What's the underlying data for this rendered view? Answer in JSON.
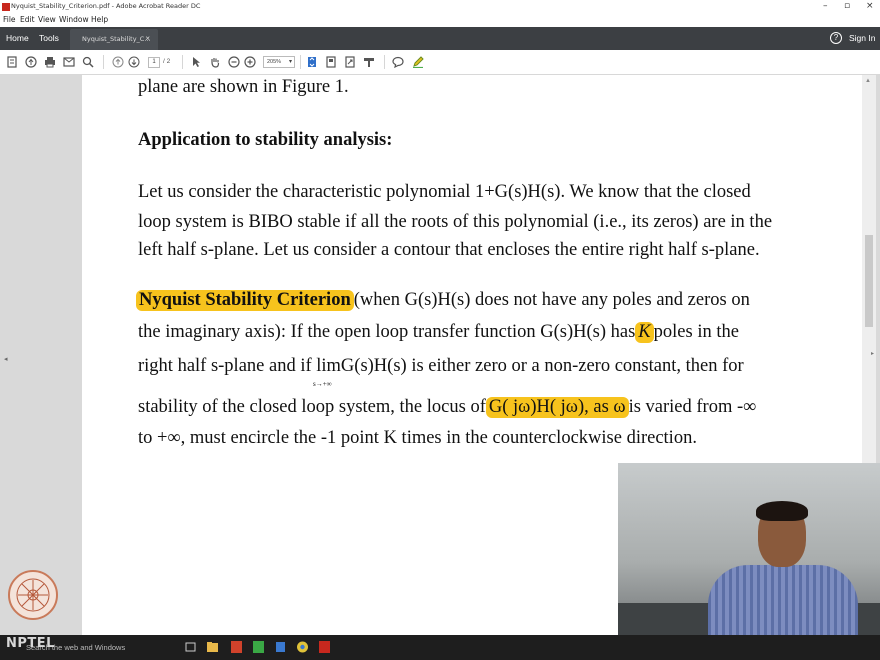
{
  "window": {
    "title": "Nyquist_Stability_Criterion.pdf - Adobe Acrobat Reader DC",
    "minimize": "–",
    "restore": "▫",
    "close": "×"
  },
  "menu": [
    "File",
    "Edit",
    "View",
    "Window",
    "Help"
  ],
  "tabs": {
    "home": "Home",
    "tools": "Tools",
    "document": "Nyquist_Stability_C...",
    "close": "×",
    "help": "?",
    "sign_in": "Sign In"
  },
  "toolbar": {
    "page_current": "1",
    "page_total": "/ 2",
    "zoom": "205%"
  },
  "document": {
    "line_prev": "plane are shown in Figure 1.",
    "heading": "Application to stability analysis:",
    "para1": [
      "Let us consider the characteristic polynomial 1+G(s)H(s). We know that the closed",
      "loop system is BIBO stable if all the roots of this polynomial (i.e., its zeros) are in the",
      "left half s-plane. Let us consider a contour that encloses the entire right half s-plane."
    ],
    "criterion_title": "Nyquist Stability Criterion",
    "crit_l1_rest": "(when  G(s)H(s)  does not have any poles and zeros on",
    "crit_l2_a": "the imaginary axis): If the open loop transfer function  G(s)H(s)  has",
    "crit_l2_k": "K",
    "crit_l2_b": "poles in the",
    "crit_l3": "right half s-plane and if  limG(s)H(s)  is either zero or a non-zero constant, then for",
    "lim_sub": "s→+∞",
    "crit_l4_a": "stability of the closed loop system, the locus of",
    "crit_l4_hl": "G( jω)H( jω), as ω",
    "crit_l4_b": "is varied from -∞",
    "crit_l5": "to +∞, must encircle the -1 point K times in the counterclockwise direction."
  },
  "taskbar": {
    "search": "Search the web and Windows"
  },
  "watermark": "NPTEL",
  "colors": {
    "highlight": "#f7c31d",
    "tabbar": "#3c3f43",
    "taskbar": "#1e1e1e"
  }
}
